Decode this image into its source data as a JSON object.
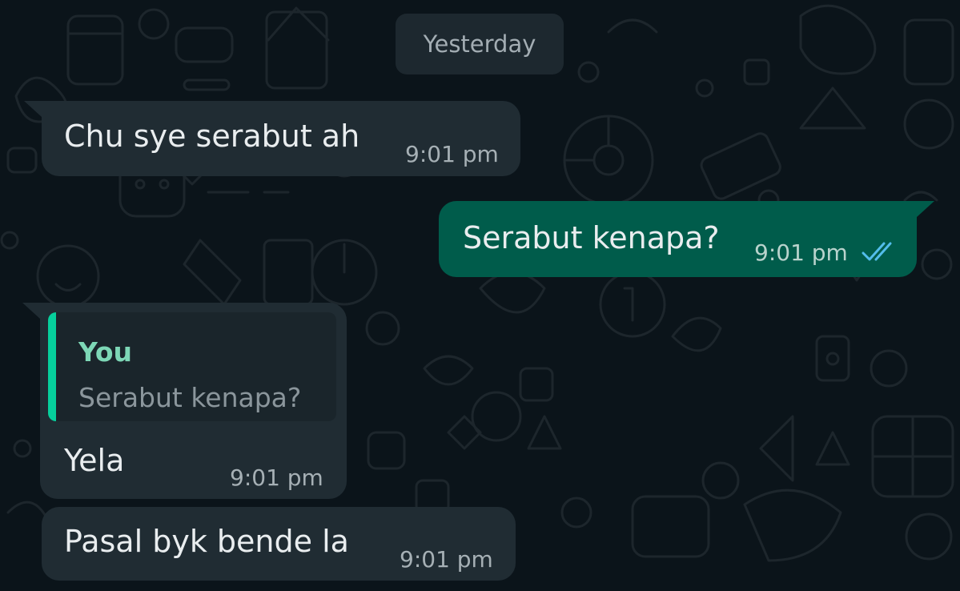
{
  "date_separator": "Yesterday",
  "messages": [
    {
      "direction": "incoming",
      "text": "Chu sye serabut ah",
      "time": "9:01 pm"
    },
    {
      "direction": "outgoing",
      "text": "Serabut kenapa?",
      "time": "9:01 pm",
      "status_icon": "double-check-icon",
      "status_color": "#53bdeb"
    },
    {
      "direction": "incoming",
      "quote": {
        "author": "You",
        "text": "Serabut kenapa?"
      },
      "text": "Yela",
      "time": "9:01 pm"
    },
    {
      "direction": "incoming",
      "text": "Pasal byk bende la",
      "time": "9:01 pm"
    }
  ],
  "colors": {
    "background": "#0b141a",
    "incoming_bubble": "#202c33",
    "outgoing_bubble": "#005c4b",
    "quote_bar": "#06cf9c",
    "quote_author": "#7dd7b6",
    "read_ticks": "#53bdeb"
  }
}
